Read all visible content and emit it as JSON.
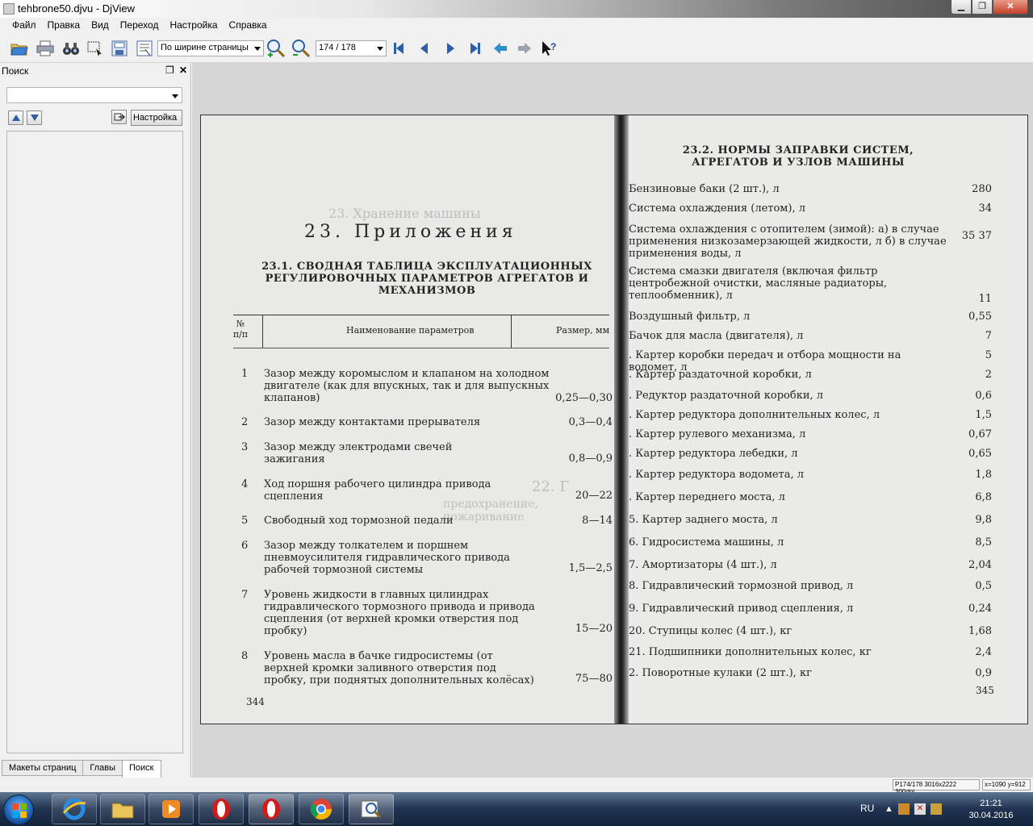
{
  "window": {
    "title": "tehbrone50.djvu - DjView"
  },
  "menu": [
    "Файл",
    "Правка",
    "Вид",
    "Переход",
    "Настройка",
    "Справка"
  ],
  "toolbar": {
    "zoom_mode": "По ширине страницы",
    "page_indicator": "174 / 178"
  },
  "sidebar": {
    "title": "Поиск",
    "search_value": "",
    "settings_label": "Настройка",
    "tabs": [
      "Макеты страниц",
      "Главы",
      "Поиск"
    ],
    "active_tab": "Поиск"
  },
  "left_page": {
    "heading": "23. Приложения",
    "subheading": "23.1. СВОДНАЯ ТАБЛИЦА ЭКСПЛУАТАЦИОННЫХ РЕГУЛИРОВОЧНЫХ ПАРАМЕТРОВ АГРЕГАТОВ И МЕХАНИЗМОВ",
    "col_num": "№ п/п",
    "col_name": "Наименование параметров",
    "col_size": "Размер, мм",
    "rows": [
      {
        "num": "1",
        "text": "Зазор между коромыслом и клапаном на холодном двигателе (как для впускных, так и для выпускных клапанов)",
        "value": "0,25—0,30"
      },
      {
        "num": "2",
        "text": "Зазор между контактами прерывателя",
        "value": "0,3—0,4"
      },
      {
        "num": "3",
        "text": "Зазор между электродами свечей зажигания",
        "value": "0,8—0,9"
      },
      {
        "num": "4",
        "text": "Ход поршня рабочего цилиндра привода сцепления",
        "value": "20—22"
      },
      {
        "num": "5",
        "text": "Свободный ход тормозной педали",
        "value": "8—14"
      },
      {
        "num": "6",
        "text": "Зазор между толкателем и поршнем пневмоусилителя гидравлического привода рабочей тормозной системы",
        "value": "1,5—2,5"
      },
      {
        "num": "7",
        "text": "Уровень жидкости в главных цилиндрах гидравлического тормозного привода и привода сцепления (от верхней кромки отверстия под пробку)",
        "value": "15—20"
      },
      {
        "num": "8",
        "text": "Уровень масла в бачке гидросистемы (от верхней кромки заливного отверстия под пробку, при поднятых дополнительных колёсах)",
        "value": "75—80"
      }
    ],
    "page_number": "344"
  },
  "right_page": {
    "heading": "23.2. НОРМЫ ЗАПРАВКИ СИСТЕМ, АГРЕГАТОВ И УЗЛОВ МАШИНЫ",
    "rows": [
      {
        "text": "Бензиновые баки (2 шт.), л",
        "value": "280"
      },
      {
        "text": "Система охлаждения (летом), л",
        "value": "34"
      },
      {
        "text": "Система охлаждения с отопителем (зимой): а) в случае применения низкозамерзающей жидкости, л б) в случае применения воды, л",
        "value": "35 37"
      },
      {
        "text": "Система смазки двигателя (включая фильтр центробежной очистки, масляные радиаторы, теплообменник), л",
        "value": "11"
      },
      {
        "text": "Воздушный фильтр, л",
        "value": "0,55"
      },
      {
        "text": "Бачок для масла (двигателя), л",
        "value": "7"
      },
      {
        "text": ". Картер коробки передач и отбора мощности на водомет, л",
        "value": "5"
      },
      {
        "text": ". Картер раздаточной коробки, л",
        "value": "2"
      },
      {
        "text": ". Редуктор раздаточной коробки, л",
        "value": "0,6"
      },
      {
        "text": ". Картер редуктора дополнительных колес, л",
        "value": "1,5"
      },
      {
        "text": ". Картер рулевого механизма, л",
        "value": "0,67"
      },
      {
        "text": ". Картер редуктора лебедки, л",
        "value": "0,65"
      },
      {
        "text": ". Картер редуктора водомета, л",
        "value": "1,8"
      },
      {
        "text": ". Картер переднего моста, л",
        "value": "6,8"
      },
      {
        "text": "5. Картер заднего моста, л",
        "value": "9,8"
      },
      {
        "text": "6. Гидросистема машины, л",
        "value": "8,5"
      },
      {
        "text": "7. Амортизаторы (4 шт.), л",
        "value": "2,04"
      },
      {
        "text": "8. Гидравлический тормозной привод, л",
        "value": "0,5"
      },
      {
        "text": "9. Гидравлический привод сцепления, л",
        "value": "0,24"
      },
      {
        "text": "20. Ступицы колес (4 шт.), кг",
        "value": "1,68"
      },
      {
        "text": "21. Подшипники дополнительных колес, кг",
        "value": "2,4"
      },
      {
        "text": "2. Поворотные кулаки (2 шт.), кг",
        "value": "0,9"
      }
    ],
    "page_number": "345"
  },
  "ghost_text": [
    "23. Хранение машины",
    "22. Г",
    "предохранение, пожаривание"
  ],
  "status": {
    "page_info": "P174/178 3016x2222 300dpi",
    "coords": "x=1090 y=912"
  },
  "taskbar": {
    "language": "RU",
    "time": "21:21",
    "date": "30.04.2016"
  },
  "colors": {
    "accent": "#1d5fae",
    "close": "#c4412b"
  }
}
